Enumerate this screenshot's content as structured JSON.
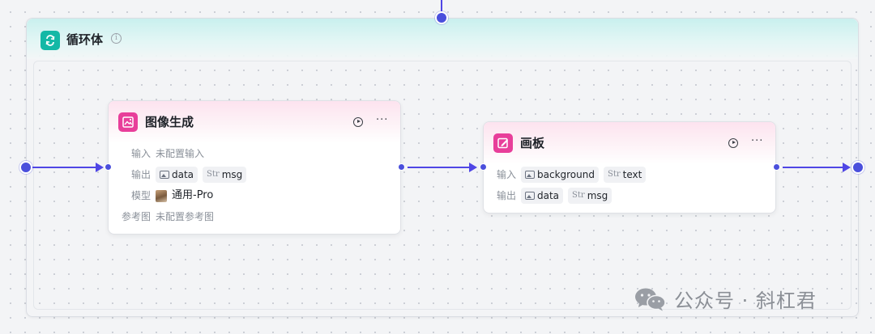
{
  "loop": {
    "title": "循环体",
    "info_icon": "info-icon",
    "icon": "loop-icon",
    "accent": "#14b8a6"
  },
  "nodes": {
    "image_gen": {
      "title": "图像生成",
      "icon": "image-icon",
      "input_label": "输入",
      "input_value": "未配置输入",
      "output_label": "输出",
      "output_tags": [
        {
          "type": "image-icon",
          "name": "data"
        },
        {
          "type": "Str",
          "name": "msg"
        }
      ],
      "model_label": "模型",
      "model_value": "通用-Pro",
      "ref_label": "参考图",
      "ref_value": "未配置参考图"
    },
    "canvas": {
      "title": "画板",
      "icon": "canvas-edit-icon",
      "input_label": "输入",
      "input_tags": [
        {
          "type": "image-icon",
          "name": "background"
        },
        {
          "type": "Str",
          "name": "text"
        }
      ],
      "output_label": "输出",
      "output_tags": [
        {
          "type": "image-icon",
          "name": "data"
        },
        {
          "type": "Str",
          "name": "msg"
        }
      ]
    }
  },
  "str_prefix": "Str",
  "watermark": {
    "text": "公众号 · 斜杠君",
    "logo": "wechat-logo"
  },
  "colors": {
    "edge": "#4f46e5",
    "node_accent": "#e83e9a",
    "background": "#f3f4f6"
  }
}
